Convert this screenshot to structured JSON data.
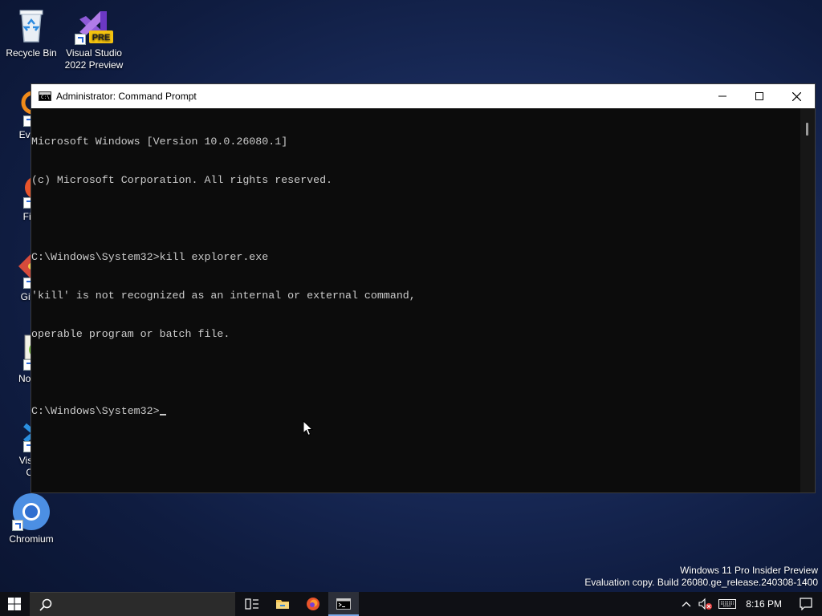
{
  "desktop": {
    "icons": [
      {
        "name": "recycle-bin",
        "label": "Recycle Bin"
      },
      {
        "name": "visual-studio-2022-preview",
        "label": "Visual Studio 2022 Preview",
        "badge": "PRE"
      },
      {
        "name": "everything",
        "label": "Every"
      },
      {
        "name": "firefox",
        "label": "Fire"
      },
      {
        "name": "git-bash",
        "label": "Git E"
      },
      {
        "name": "notepad-plus-plus",
        "label": "Notep"
      },
      {
        "name": "visual-studio-code",
        "label": "Visual Co"
      },
      {
        "name": "chromium",
        "label": "Chromium"
      }
    ],
    "watermark": {
      "line1": "Windows 11 Pro Insider Preview",
      "line2": "Evaluation copy. Build 26080.ge_release.240308-1400"
    }
  },
  "cmd_window": {
    "title": "Administrator: Command Prompt",
    "icon_glyph": "C:\\",
    "lines": [
      "Microsoft Windows [Version 10.0.26080.1]",
      "(c) Microsoft Corporation. All rights reserved.",
      "",
      "C:\\Windows\\System32>kill explorer.exe",
      "'kill' is not recognized as an internal or external command,",
      "operable program or batch file.",
      "",
      "C:\\Windows\\System32>"
    ]
  },
  "taskbar": {
    "apps": [
      "task-view",
      "file-explorer",
      "firefox",
      "command-prompt"
    ],
    "active_app": "command-prompt",
    "clock": "8:16 PM"
  },
  "colors": {
    "console_bg": "#0c0c0c",
    "console_text": "#cccccc",
    "taskbar_bg": "#0f1015",
    "accent": "#7aa7e8"
  }
}
